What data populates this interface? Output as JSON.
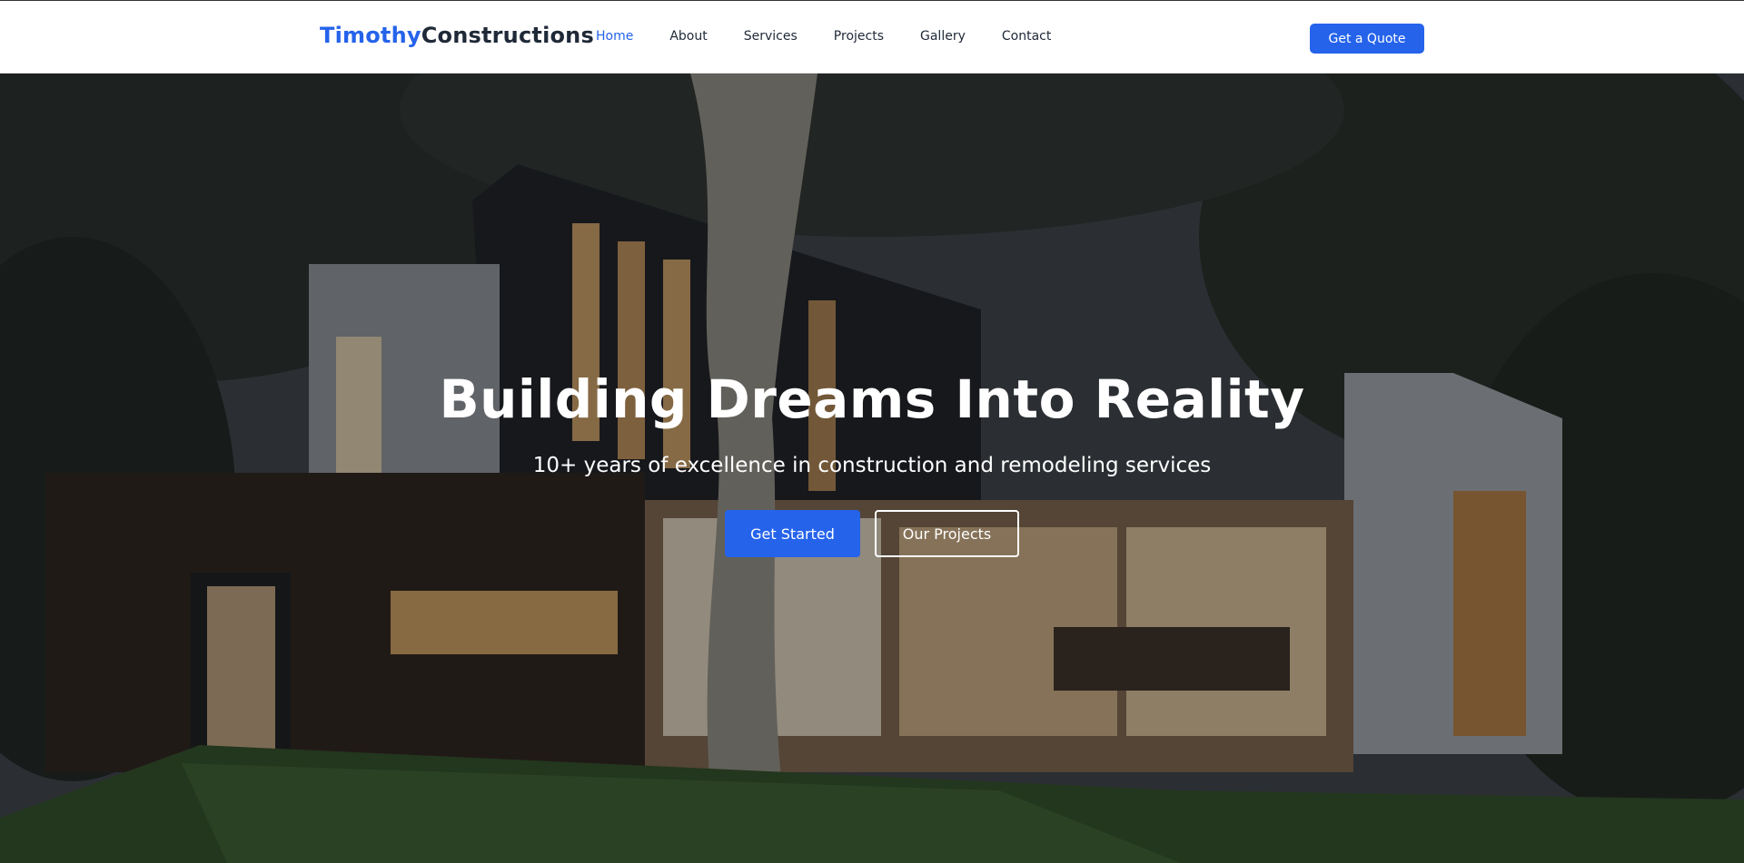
{
  "brand": {
    "part1": "Timothy",
    "part2": "Constructions"
  },
  "nav": {
    "items": [
      {
        "label": "Home",
        "active": true
      },
      {
        "label": "About"
      },
      {
        "label": "Services"
      },
      {
        "label": "Projects"
      },
      {
        "label": "Gallery"
      },
      {
        "label": "Contact"
      }
    ],
    "cta": "Get a Quote"
  },
  "hero": {
    "title": "Building Dreams Into Reality",
    "subtitle": "10+ years of excellence in construction and remodeling services",
    "primary_button": "Get Started",
    "secondary_button": "Our Projects"
  },
  "colors": {
    "accent": "#2563eb",
    "text_dark": "#1f2937",
    "hero_text": "#ffffff"
  }
}
